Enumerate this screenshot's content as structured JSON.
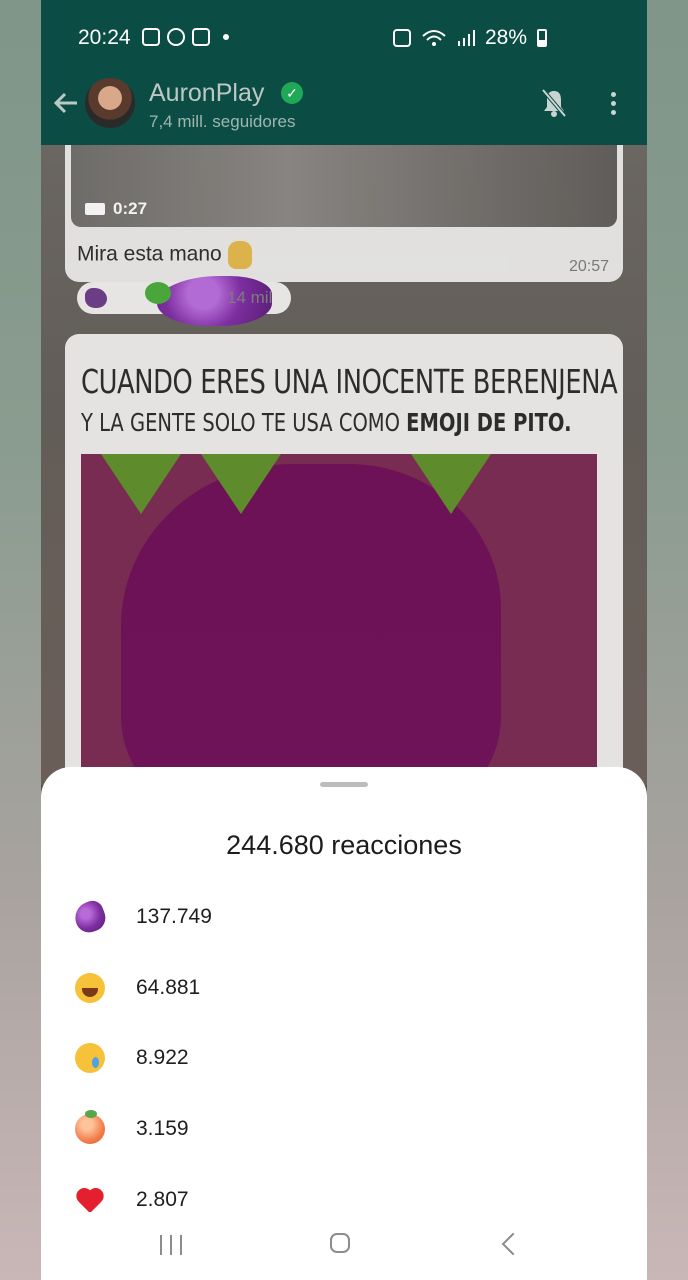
{
  "status_bar": {
    "time": "20:24",
    "battery": "28%"
  },
  "header": {
    "back_icon": "arrow-left-icon",
    "channel_name": "AuronPlay",
    "followers": "7,4 mill. seguidores",
    "mute_icon": "bell-off-icon",
    "menu_icon": "more-vertical-icon",
    "colors": {
      "background": "#0b4d44",
      "verified": "#1fa855"
    }
  },
  "chat": {
    "video_message": {
      "duration": "0:27",
      "caption": "Mira esta mano",
      "time": "20:57",
      "reactions_summary": "14 mil"
    },
    "meme": {
      "line1": "CUANDO ERES UNA INOCENTE BERENJENA",
      "line2_plain": "Y LA GENTE SOLO TE USA COMO",
      "line2_bold": "EMOJI DE PITO."
    }
  },
  "reactions_sheet": {
    "title": "244.680 reacciones",
    "items": [
      {
        "emoji": "eggplant-icon",
        "count": "137.749"
      },
      {
        "emoji": "laughing-tears-icon",
        "count": "64.881"
      },
      {
        "emoji": "crying-face-icon",
        "count": "8.922"
      },
      {
        "emoji": "peach-icon",
        "count": "3.159"
      },
      {
        "emoji": "red-heart-icon",
        "count": "2.807"
      }
    ]
  },
  "nav_bar": {
    "recent_icon": "recent-apps-icon",
    "home_icon": "home-icon",
    "back_icon": "back-icon"
  }
}
